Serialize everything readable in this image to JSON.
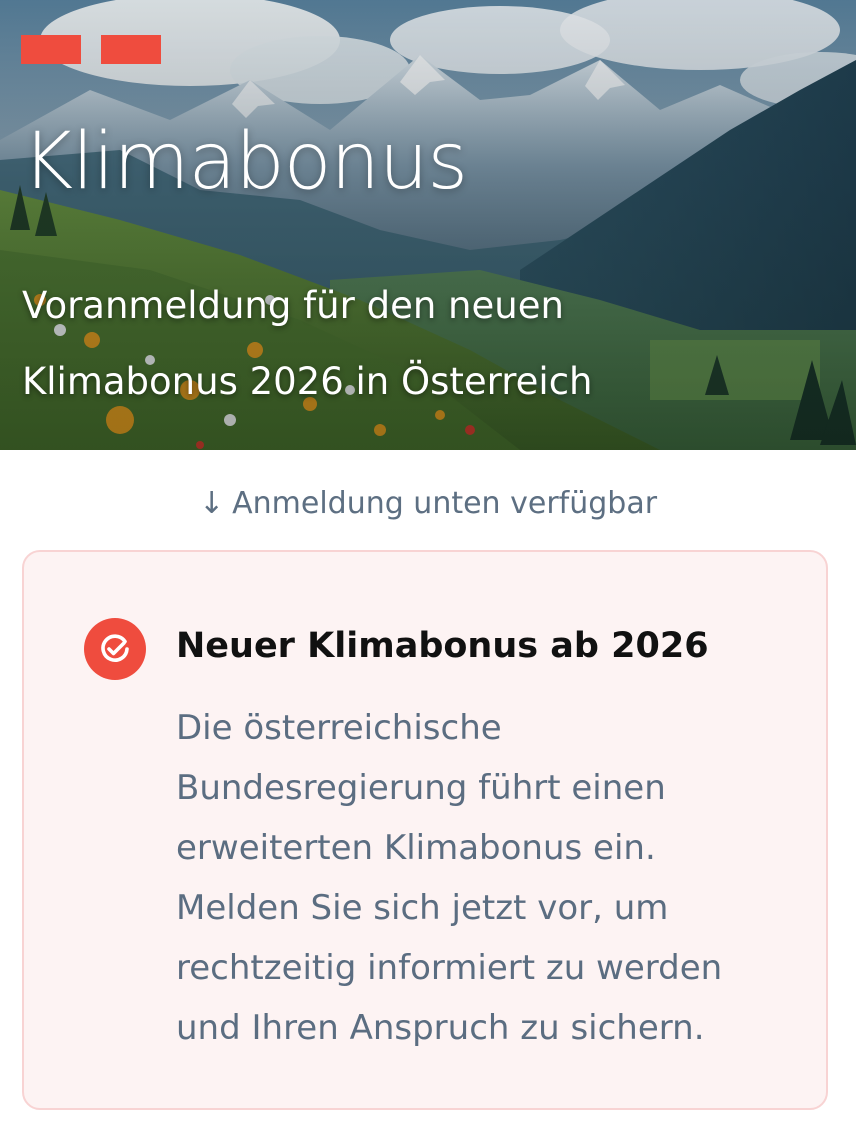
{
  "hero": {
    "title": "Klimabonus",
    "subtitle": "Voranmeldung für den neuen Klimabonus 2026 in Österreich",
    "image": "alpine-meadow-landscape"
  },
  "hint": {
    "arrow": "↓",
    "text": "Anmeldung unten verfügbar"
  },
  "card": {
    "icon": "check-circle-icon",
    "title": "Neuer Klimabonus ab 2026",
    "body": "Die österreichische Bundesregierung führt einen erweiterten Klimabonus ein. Melden Sie sich jetzt vor, um rechtzeitig informiert zu werden und Ihren Anspruch zu sichern."
  },
  "colors": {
    "accent": "#ef4c3e",
    "muted_text": "#5d6f82",
    "card_background": "#fdf3f3",
    "card_border": "#f8d3d3"
  }
}
